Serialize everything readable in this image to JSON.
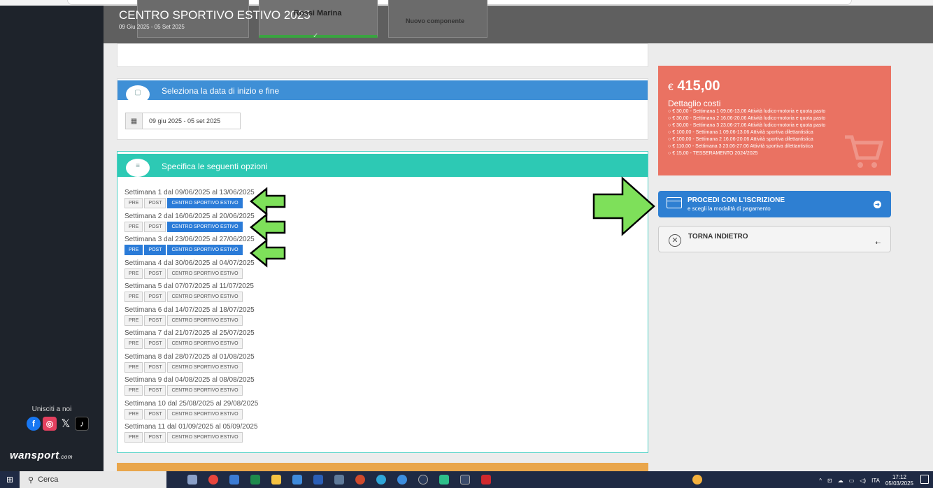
{
  "header": {
    "title": "CENTRO SPORTIVO ESTIVO 2025",
    "subtitle": "09 Giu 2025 - 05 Set 2025",
    "selected_member": "Rossi Marina",
    "new_member_label": "Nuovo componente"
  },
  "dates_section": {
    "title": "Seleziona la data di inizio e fine",
    "range_value": "09 giu 2025 - 05 set 2025"
  },
  "options_section": {
    "title": "Specifica le seguenti opzioni",
    "chip_labels": {
      "pre": "PRE",
      "post": "POST",
      "centro": "CENTRO SPORTIVO ESTIVO"
    },
    "weeks": [
      {
        "label": "Settimana 1 dal 09/06/2025 al 13/06/2025",
        "pre": false,
        "post": false,
        "centro": true
      },
      {
        "label": "Settimana 2 dal 16/06/2025 al 20/06/2025",
        "pre": false,
        "post": false,
        "centro": true
      },
      {
        "label": "Settimana 3 dal 23/06/2025 al 27/06/2025",
        "pre": true,
        "post": true,
        "centro": true
      },
      {
        "label": "Settimana 4 dal 30/06/2025 al 04/07/2025",
        "pre": false,
        "post": false,
        "centro": false
      },
      {
        "label": "Settimana 5 dal 07/07/2025 al 11/07/2025",
        "pre": false,
        "post": false,
        "centro": false
      },
      {
        "label": "Settimana 6 dal 14/07/2025 al 18/07/2025",
        "pre": false,
        "post": false,
        "centro": false
      },
      {
        "label": "Settimana 7 dal 21/07/2025 al 25/07/2025",
        "pre": false,
        "post": false,
        "centro": false
      },
      {
        "label": "Settimana 8 dal 28/07/2025 al 01/08/2025",
        "pre": false,
        "post": false,
        "centro": false
      },
      {
        "label": "Settimana 9 dal 04/08/2025 al 08/08/2025",
        "pre": false,
        "post": false,
        "centro": false
      },
      {
        "label": "Settimana 10 dal 25/08/2025 al 29/08/2025",
        "pre": false,
        "post": false,
        "centro": false
      },
      {
        "label": "Settimana 11 dal 01/09/2025 al 05/09/2025",
        "pre": false,
        "post": false,
        "centro": false
      }
    ]
  },
  "costs": {
    "currency": "€",
    "total": "415,00",
    "title": "Dettaglio costi",
    "lines": [
      "€ 30,00 - Settimana 1 09.06-13.06 Attività ludico-motoria e quota pasto",
      "€ 30,00 - Settimana 2 16.06-20.06 Attività ludico-motoria e quota pasto",
      "€ 30,00 - Settimana 3 23.06-27.06 Attività ludico-motoria e quota pasto",
      "€ 100,00 - Settimana 1 09.06-13.06 Attività sportiva dilettantistica",
      "€ 100,00 - Settimana 2 16.06-20.06 Attività sportiva dilettantistica",
      "€ 110,00 - Settimana 3 23.06-27.06 Attività sportiva dilettantistica",
      "€ 15,00 - TESSERAMENTO 2024/2025"
    ]
  },
  "actions": {
    "proceed_title": "PROCEDI CON L'ISCRIZIONE",
    "proceed_sub": "e scegli la modalità di pagamento",
    "back_title": "TORNA INDIETRO"
  },
  "sidebar": {
    "join_label": "Unisciti a noi",
    "brand": "wansport",
    "brand_suffix": ".com"
  },
  "taskbar": {
    "search_label": "Cerca",
    "lang": "ITA",
    "time": "17:12",
    "date": "05/03/2025"
  },
  "colors": {
    "accent_blue": "#2a7bd8",
    "teal": "#2dc9b4",
    "cost_red": "#ea7262",
    "arrow_green": "#7ee05a"
  }
}
